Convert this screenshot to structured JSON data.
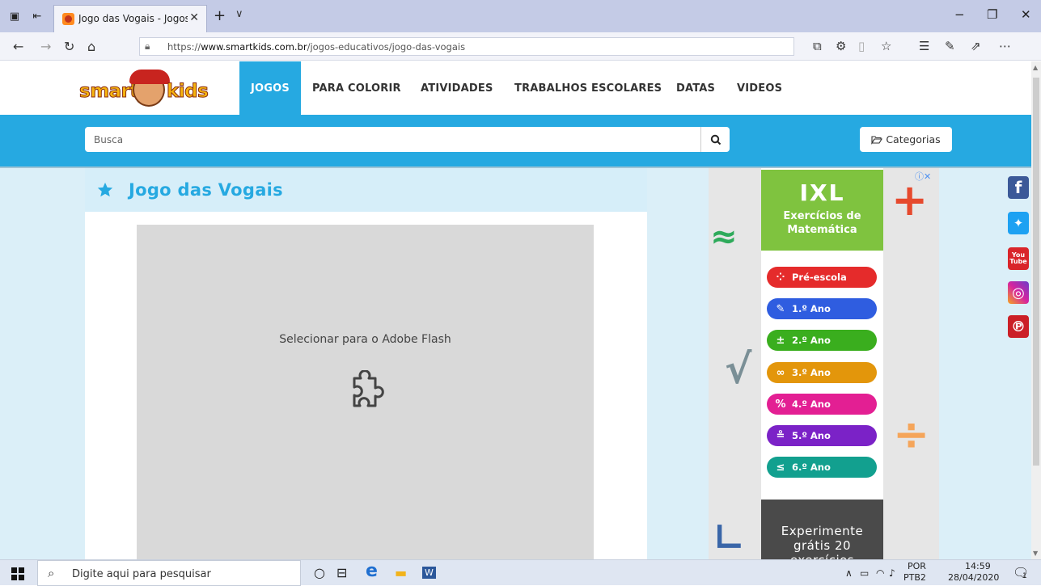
{
  "browser": {
    "tab_title": "Jogo das Vogais - Jogos",
    "tab_close": "✕",
    "new_tab": "+",
    "tab_menu": "∨",
    "url_prefix": "https://",
    "url_domain": "www.smartkids.com.br",
    "url_path": "/jogos-educativos/jogo-das-vogais"
  },
  "site": {
    "logo_left": "smart",
    "logo_right": "kids",
    "menu": [
      {
        "label": "JOGOS",
        "active": true
      },
      {
        "label": "PARA COLORIR",
        "active": false
      },
      {
        "label": "ATIVIDADES",
        "active": false
      },
      {
        "label": "TRABALHOS ESCOLARES",
        "active": false
      },
      {
        "label": "DATAS",
        "active": false
      },
      {
        "label": "VIDEOS",
        "active": false
      }
    ],
    "search_placeholder": "Busca",
    "categories_label": "Categorias"
  },
  "game": {
    "title": "Jogo das Vogais",
    "flash_message": "Selecionar para o Adobe Flash"
  },
  "ad": {
    "brand": "IXL",
    "headline_1": "Exercícios de",
    "headline_2": "Matemática",
    "grades": [
      {
        "label": "Pré-escola",
        "icon": "⁘",
        "color": "#e52b2b"
      },
      {
        "label": "1.º Ano",
        "icon": "✎",
        "color": "#2f5de0"
      },
      {
        "label": "2.º Ano",
        "icon": "±",
        "color": "#3aae1e"
      },
      {
        "label": "3.º Ano",
        "icon": "∞",
        "color": "#e3960b"
      },
      {
        "label": "4.º Ano",
        "icon": "%",
        "color": "#e31f93"
      },
      {
        "label": "5.º Ano",
        "icon": "≗",
        "color": "#7b22c7"
      },
      {
        "label": "6.º Ano",
        "icon": "≤",
        "color": "#12a08f"
      }
    ],
    "promo_1": "Experimente",
    "promo_2": "grátis 20",
    "promo_3": "exercícios"
  },
  "social": [
    {
      "name": "facebook",
      "glyph": "f",
      "color": "#3b5998"
    },
    {
      "name": "twitter",
      "glyph": "🐦",
      "color": "#1da1f2"
    },
    {
      "name": "youtube",
      "glyph": "You Tube",
      "color": "#d9252a"
    },
    {
      "name": "instagram",
      "glyph": "◎",
      "color": "#d6249f"
    },
    {
      "name": "pinterest",
      "glyph": "℗",
      "color": "#cb2027"
    }
  ],
  "taskbar": {
    "search_placeholder": "Digite aqui para pesquisar",
    "language": "POR",
    "layout": "PTB2",
    "time": "14:59",
    "date": "28/04/2020",
    "notifications": "1"
  }
}
